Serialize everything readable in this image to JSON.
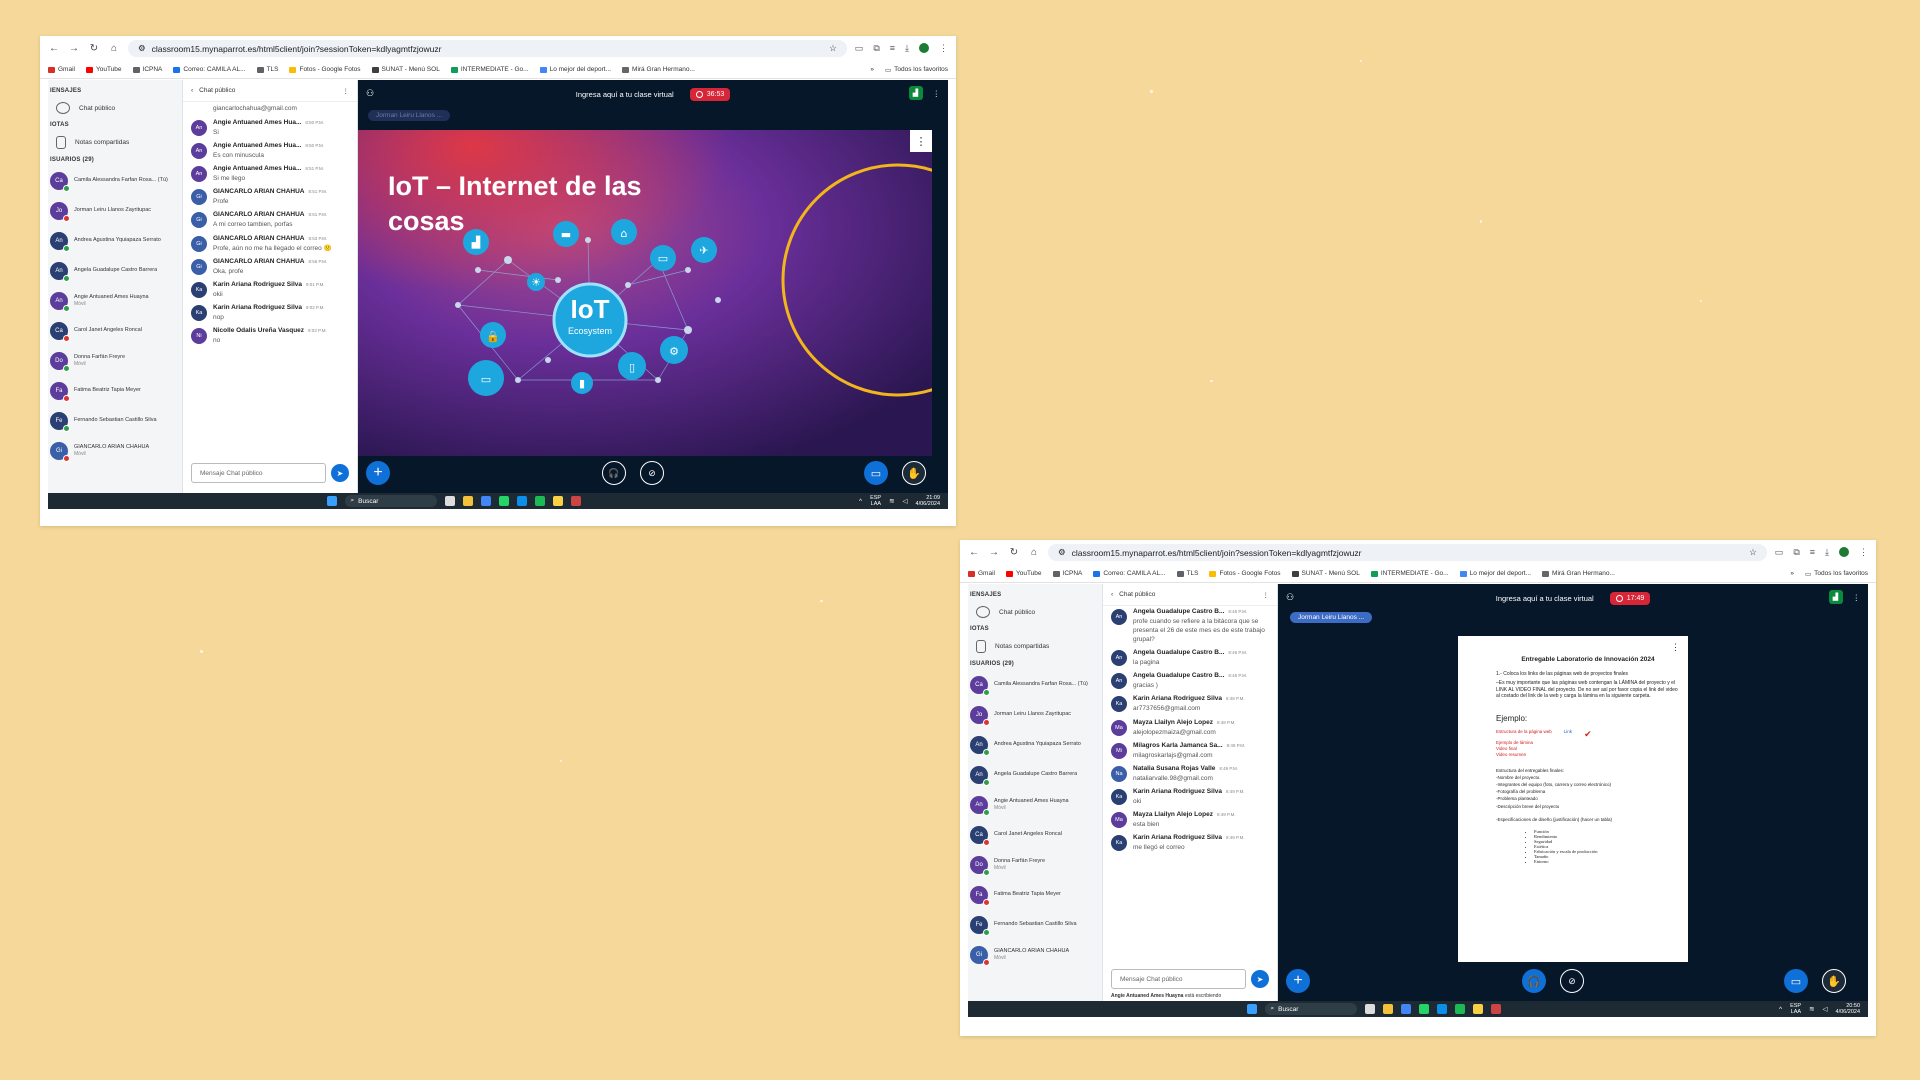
{
  "screenshot1": {
    "url": "classroom15.mynaparrot.es/html5client/join?sessionToken=kdlyagmtfzjowuzr",
    "bookmarks": [
      "Gmail",
      "YouTube",
      "ICPNA",
      "Correo: CAMILA AL...",
      "TLS",
      "Fotos - Google Fotos",
      "SUNAT - Menú SOL",
      "INTERMEDIATE - Go...",
      "Lo mejor del deport...",
      "Mirá Gran Hermano..."
    ],
    "bookmarks_all": "Todos los favoritos",
    "sidebar": {
      "messages_header": "IENSAJES",
      "public_chat": "Chat público",
      "notes_header": "IOTAS",
      "shared_notes": "Notas compartidas",
      "users_header": "ISUARIOS (29)",
      "users": [
        {
          "initials": "Ca",
          "name": "Camila Alessandra Farfan Rosa... (Tú)",
          "sub": "",
          "color": "#5c3d9c"
        },
        {
          "initials": "Jo",
          "name": "Jorman Leiru Llanos Zayritupac",
          "sub": "",
          "color": "#5c3d9c"
        },
        {
          "initials": "An",
          "name": "Andrea Agustina Yquiapaza Serrato",
          "sub": "",
          "color": "#2a3f72"
        },
        {
          "initials": "An",
          "name": "Angela Guadalupe Castro Barrera",
          "sub": "",
          "color": "#2a3f72"
        },
        {
          "initials": "An",
          "name": "Angie Antuaned Ames Huayna",
          "sub": "Móvil",
          "color": "#5c3d9c"
        },
        {
          "initials": "Ca",
          "name": "Carol Janet Angeles Roncal",
          "sub": "",
          "color": "#2a3f72"
        },
        {
          "initials": "Do",
          "name": "Donna Farfán Freyre",
          "sub": "Móvil",
          "color": "#5c3d9c"
        },
        {
          "initials": "Fa",
          "name": "Fatima Beatriz Tapia Meyer",
          "sub": "",
          "color": "#5c3d9c"
        },
        {
          "initials": "Fe",
          "name": "Fernando Sebastian Castillo Silva",
          "sub": "",
          "color": "#2a3f72"
        },
        {
          "initials": "Gi",
          "name": "GIANCARLO ARIAN CHAHUA",
          "sub": "Móvil",
          "color": "#3a5fa8"
        }
      ]
    },
    "chat": {
      "title": "Chat público",
      "top_fragment": "giancarlochahua@gmail.com",
      "messages": [
        {
          "initials": "An",
          "name": "Angie Antuaned Ames Hua...",
          "time": "8:50 P.M.",
          "text": "Si",
          "color": "#5c3d9c"
        },
        {
          "initials": "An",
          "name": "Angie Antuaned Ames Hua...",
          "time": "8:50 P.M.",
          "text": "Es con minuscula",
          "color": "#5c3d9c"
        },
        {
          "initials": "An",
          "name": "Angie Antuaned Ames Hua...",
          "time": "8:51 P.M.",
          "text": "Si me llego",
          "color": "#5c3d9c"
        },
        {
          "initials": "Gi",
          "name": "GIANCARLO ARIAN CHAHUA",
          "time": "8:51 P.M.",
          "text": "Profe",
          "color": "#3a5fa8"
        },
        {
          "initials": "Gi",
          "name": "GIANCARLO ARIAN CHAHUA",
          "time": "8:51 P.M.",
          "text": "A mi correo tambien, porfas",
          "color": "#3a5fa8"
        },
        {
          "initials": "Gi",
          "name": "GIANCARLO ARIAN CHAHUA",
          "time": "8:53 P.M.",
          "text": "Profe, aún no me ha llegado el correo 🙁",
          "color": "#3a5fa8"
        },
        {
          "initials": "Gi",
          "name": "GIANCARLO ARIAN CHAHUA",
          "time": "8:56 P.M.",
          "text": "Oka, profe",
          "color": "#3a5fa8"
        },
        {
          "initials": "Ka",
          "name": "Karin Ariana Rodriguez Silva",
          "time": "9:01 P.M.",
          "text": "okii",
          "color": "#2a3f72"
        },
        {
          "initials": "Ka",
          "name": "Karin Ariana Rodriguez Silva",
          "time": "9:02 P.M.",
          "text": "nop",
          "color": "#2a3f72"
        },
        {
          "initials": "Ni",
          "name": "Nicolle Odalis Ureña Vasquez",
          "time": "9:03 P.M.",
          "text": "no",
          "color": "#5c3d9c"
        }
      ],
      "input_placeholder": "Mensaje Chat público"
    },
    "main": {
      "header": "Ingresa aquí a tu clase virtual",
      "timer": "36:53",
      "presenter": "Jorman Leiru Llanos ...",
      "slide_title_line1": "IoT – Internet de las",
      "slide_title_line2": "cosas",
      "hub_big": "IoT",
      "hub_small": "Ecosystem"
    },
    "taskbar": {
      "search": "Buscar",
      "lang": "ESP",
      "lang2": "LAA",
      "time": "21:09",
      "date": "4/06/2024"
    }
  },
  "screenshot2": {
    "url": "classroom15.mynaparrot.es/html5client/join?sessionToken=kdlyagmtfzjowuzr",
    "chat": {
      "title": "Chat público",
      "messages": [
        {
          "initials": "An",
          "name": "Angela Guadalupe Castro B...",
          "time": "8:46 P.M.",
          "text": "profe cuando se refiere a la bitácora que se presenta el 26 de este mes es de este trabajo grupal?",
          "color": "#2a3f72"
        },
        {
          "initials": "An",
          "name": "Angela Guadalupe Castro B...",
          "time": "8:46 P.M.",
          "text": "la pagina",
          "color": "#2a3f72"
        },
        {
          "initials": "An",
          "name": "Angela Guadalupe Castro B...",
          "time": "8:46 P.M.",
          "text": "gracias )",
          "color": "#2a3f72"
        },
        {
          "initials": "Ka",
          "name": "Karin Ariana Rodriguez Silva",
          "time": "8:48 P.M.",
          "text": "ar7737656@gmail.com",
          "color": "#2a3f72"
        },
        {
          "initials": "Ma",
          "name": "Mayza Llailyn Alejo Lopez",
          "time": "8:48 P.M.",
          "text": "alejolopezmaiza@gmail.com",
          "color": "#5c3d9c"
        },
        {
          "initials": "Mi",
          "name": "Milagros Karla Jamanca Sa...",
          "time": "8:49 P.M.",
          "text": "milagroskarlajs@gmail.com",
          "color": "#5c3d9c"
        },
        {
          "initials": "Na",
          "name": "Natalia Susana Rojas Valle",
          "time": "8:49 P.M.",
          "text": "nataliarvalle.98@gmail.com",
          "color": "#3a5fa8"
        },
        {
          "initials": "Ka",
          "name": "Karin Ariana Rodriguez Silva",
          "time": "8:49 P.M.",
          "text": "oki",
          "color": "#2a3f72"
        },
        {
          "initials": "Ma",
          "name": "Mayza Llailyn Alejo Lopez",
          "time": "8:49 P.M.",
          "text": "esta bien",
          "color": "#5c3d9c"
        },
        {
          "initials": "Ka",
          "name": "Karin Ariana Rodriguez Silva",
          "time": "8:49 P.M.",
          "text": "me llegó el correo",
          "color": "#2a3f72"
        }
      ],
      "input_placeholder": "Mensaje Chat público",
      "typing_name": "Angie Antuaned Ames Huayna",
      "typing_text": "está escribiendo"
    },
    "main": {
      "header": "Ingresa aquí a tu clase virtual",
      "timer": "17:49",
      "presenter": "Jorman Leiru Llanos ...",
      "doc_title": "Entregable Laboratorio de Innovación 2024",
      "doc_line1": "1.- Coloca   los links de las páginas web de proyectos finales",
      "doc_line2": "–Es muy importante que las páginas web  contengan la LÁMINA del proyecto  y el LINK AL VIDEO FINAL  del proyecto. De no ser así por favor copia el link del video al costado del link de la web y carga la lámina en la siguiente carpeta.",
      "doc_example": "Ejemplo:",
      "doc_ex_lines": [
        "Estructura de la página web",
        "Ejemplo de lámina",
        "Video final",
        "Video resumen"
      ],
      "doc_link": "Link",
      "doc_struct": [
        "Estructura del entregables finales:",
        "-Nombre del proyecto.",
        "-Integrantes del equipo (foto, carrera y correo electrónico)",
        "-Fotografía del problema",
        "-Problema planteado",
        "-Descripción breve del proyecto",
        "",
        "-Especificaciones de diseño (justificación) (hacer un tabla)"
      ],
      "doc_bullets": [
        "Función",
        "Rendimiento",
        "Seguridad",
        "Estética",
        "Fabricación y escala de producción",
        "Tamaño",
        "Entorno"
      ]
    },
    "taskbar": {
      "search": "Buscar",
      "lang": "ESP",
      "lang2": "LAA",
      "time": "20:50",
      "date": "4/06/2024"
    }
  }
}
